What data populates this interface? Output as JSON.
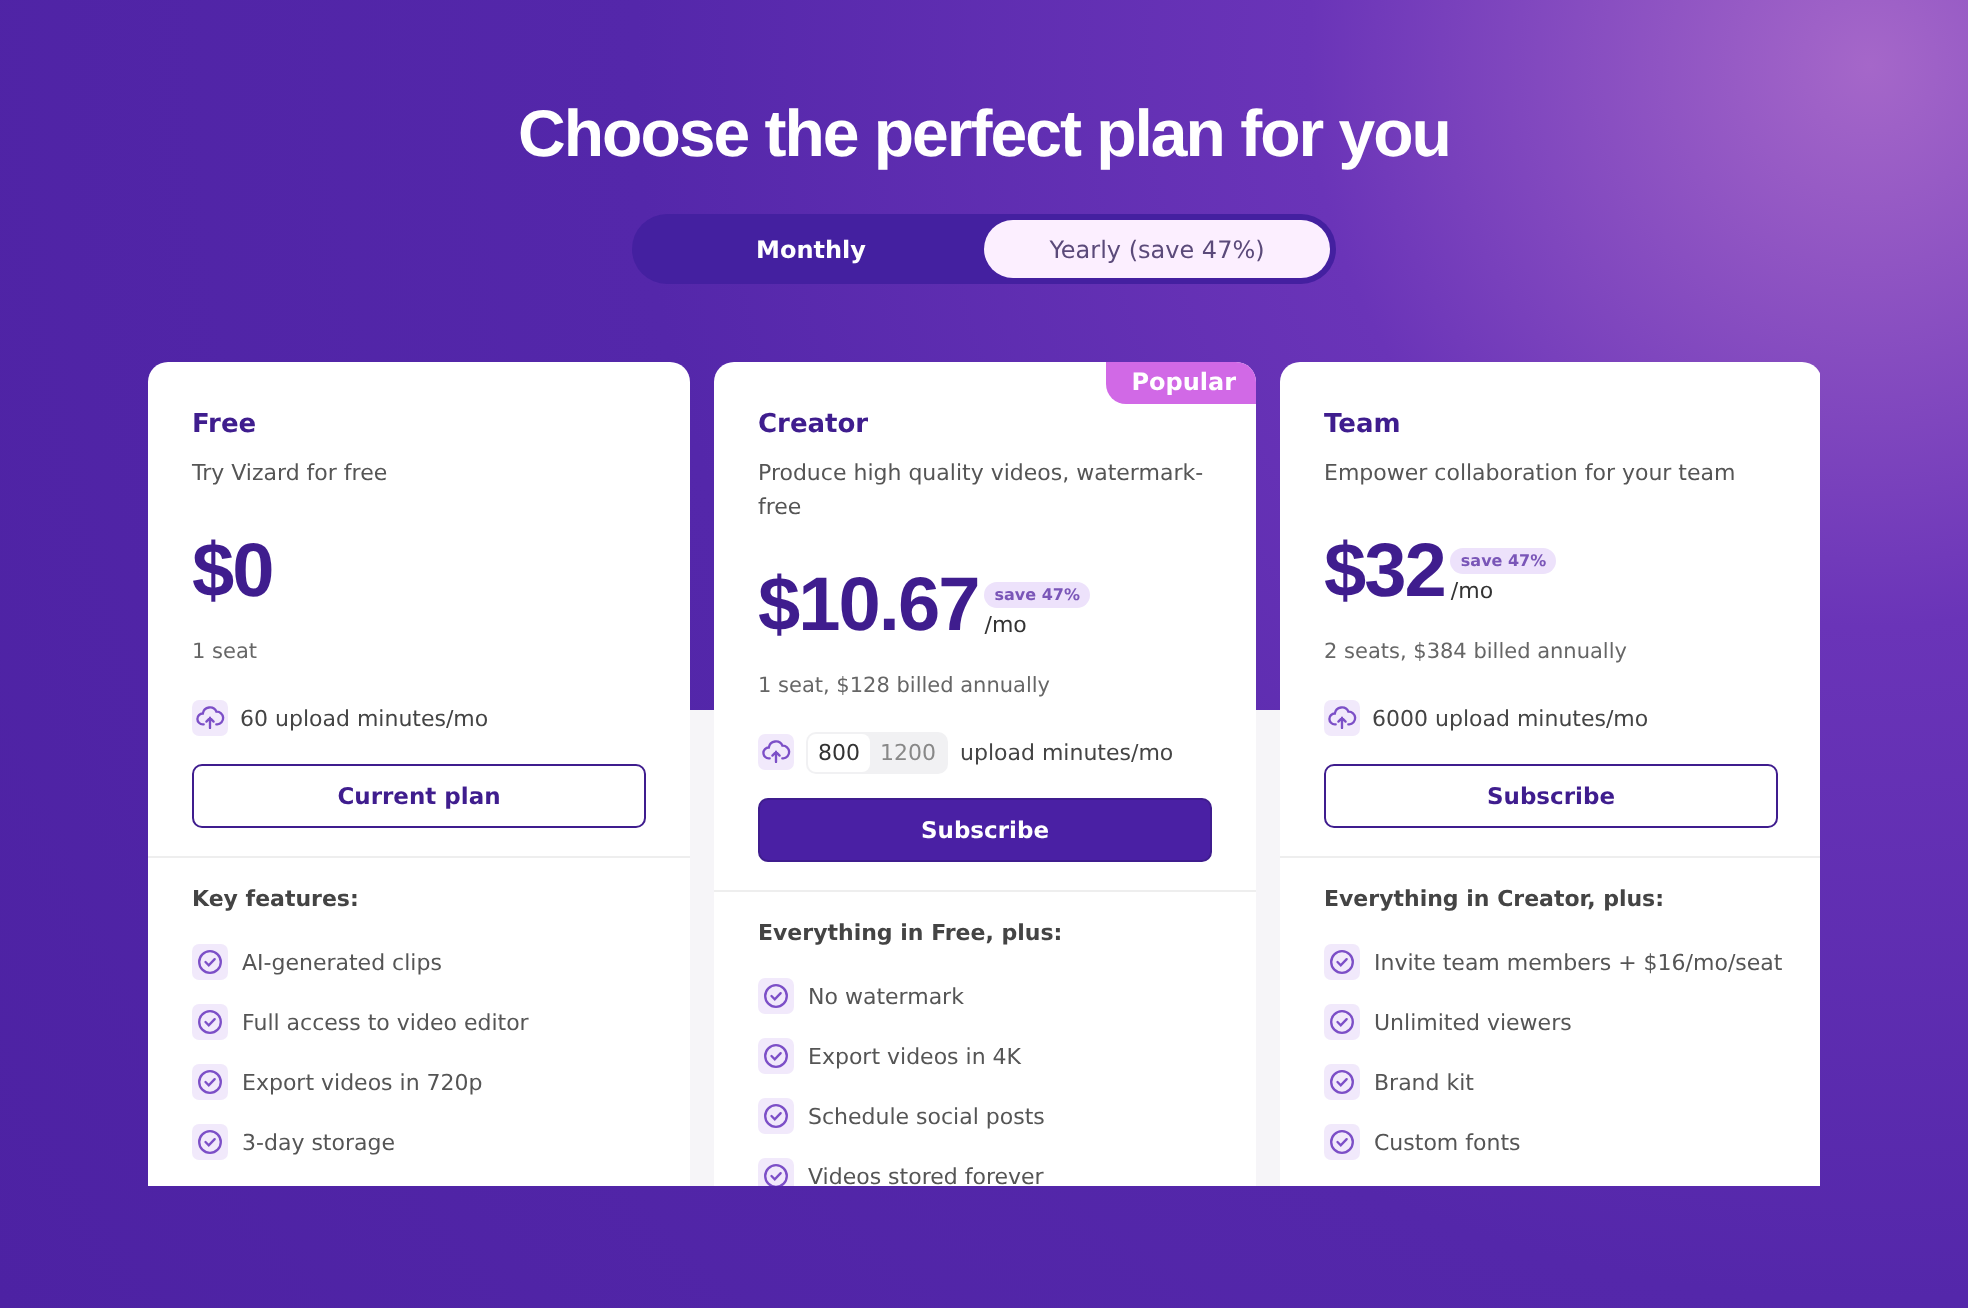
{
  "title": "Choose the perfect plan for you",
  "billing_tabs": [
    {
      "label": "Monthly",
      "selected": false
    },
    {
      "label": "Yearly (save 47%)",
      "selected": true
    }
  ],
  "plans": [
    {
      "name": "Free",
      "description": "Try Vizard for free",
      "price": "$0",
      "seats": "1 seat",
      "upload": {
        "kind": "fixed",
        "text": "60 upload minutes/mo"
      },
      "button": {
        "label": "Current plan",
        "primary": false
      },
      "features_heading": "Key features:",
      "features": [
        "AI-generated clips",
        "Full access to video editor",
        "Export videos in 720p",
        "3-day storage"
      ]
    },
    {
      "name": "Creator",
      "description": "Produce high quality videos, watermark-free",
      "price": "$10.67",
      "save": "save 47%",
      "per": "/mo",
      "seats": "1 seat, $128 billed annually",
      "upload": {
        "kind": "choice",
        "options": [
          {
            "label": "800",
            "selected": true
          },
          {
            "label": "1200",
            "selected": false
          }
        ],
        "suffix": "upload minutes/mo"
      },
      "button": {
        "label": "Subscribe",
        "primary": true
      },
      "badge": "Popular",
      "features_heading": "Everything in Free, plus:",
      "features": [
        "No watermark",
        "Export videos in 4K",
        "Schedule social posts",
        "Videos stored forever"
      ]
    },
    {
      "name": "Team",
      "description": "Empower collaboration for your team",
      "price": "$32",
      "save": "save 47%",
      "per": "/mo",
      "seats": "2 seats, $384 billed annually",
      "upload": {
        "kind": "fixed",
        "text": "6000 upload minutes/mo"
      },
      "button": {
        "label": "Subscribe",
        "primary": false
      },
      "features_heading": "Everything in Creator, plus:",
      "features": [
        "Invite team members + $16/mo/seat",
        "Unlimited viewers",
        "Brand kit",
        "Custom fonts"
      ]
    }
  ]
}
